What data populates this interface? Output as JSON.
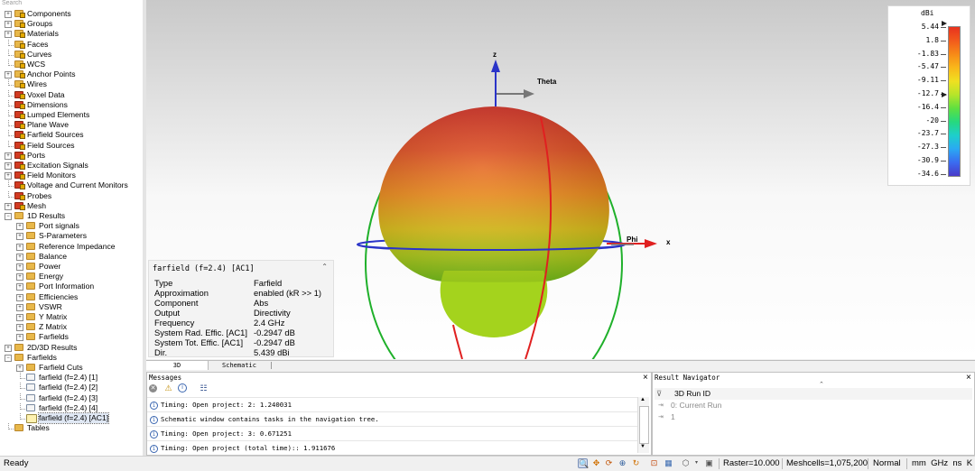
{
  "search_placeholder": "Search",
  "tree": [
    {
      "label": "Components",
      "indent": 0,
      "exp": "+",
      "icon": "folder-lock"
    },
    {
      "label": "Groups",
      "indent": 0,
      "exp": "+",
      "icon": "folder-lock"
    },
    {
      "label": "Materials",
      "indent": 0,
      "exp": "+",
      "icon": "folder-lock"
    },
    {
      "label": "Faces",
      "indent": 0,
      "exp": "",
      "icon": "folder-lock"
    },
    {
      "label": "Curves",
      "indent": 0,
      "exp": "",
      "icon": "folder-lock"
    },
    {
      "label": "WCS",
      "indent": 0,
      "exp": "",
      "icon": "folder-lock"
    },
    {
      "label": "Anchor Points",
      "indent": 0,
      "exp": "+",
      "icon": "folder-lock"
    },
    {
      "label": "Wires",
      "indent": 0,
      "exp": "",
      "icon": "folder-lock"
    },
    {
      "label": "Voxel Data",
      "indent": 0,
      "exp": "",
      "icon": "red"
    },
    {
      "label": "Dimensions",
      "indent": 0,
      "exp": "",
      "icon": "red"
    },
    {
      "label": "Lumped Elements",
      "indent": 0,
      "exp": "",
      "icon": "red"
    },
    {
      "label": "Plane Wave",
      "indent": 0,
      "exp": "",
      "icon": "red"
    },
    {
      "label": "Farfield Sources",
      "indent": 0,
      "exp": "",
      "icon": "red"
    },
    {
      "label": "Field Sources",
      "indent": 0,
      "exp": "",
      "icon": "red"
    },
    {
      "label": "Ports",
      "indent": 0,
      "exp": "+",
      "icon": "red"
    },
    {
      "label": "Excitation Signals",
      "indent": 0,
      "exp": "+",
      "icon": "red"
    },
    {
      "label": "Field Monitors",
      "indent": 0,
      "exp": "+",
      "icon": "red"
    },
    {
      "label": "Voltage and Current Monitors",
      "indent": 0,
      "exp": "",
      "icon": "red"
    },
    {
      "label": "Probes",
      "indent": 0,
      "exp": "",
      "icon": "red"
    },
    {
      "label": "Mesh",
      "indent": 0,
      "exp": "+",
      "icon": "red"
    },
    {
      "label": "1D Results",
      "indent": 0,
      "exp": "−",
      "icon": "folder"
    },
    {
      "label": "Port signals",
      "indent": 1,
      "exp": "+",
      "icon": "folder"
    },
    {
      "label": "S-Parameters",
      "indent": 1,
      "exp": "+",
      "icon": "folder"
    },
    {
      "label": "Reference Impedance",
      "indent": 1,
      "exp": "+",
      "icon": "folder"
    },
    {
      "label": "Balance",
      "indent": 1,
      "exp": "+",
      "icon": "folder"
    },
    {
      "label": "Power",
      "indent": 1,
      "exp": "+",
      "icon": "folder"
    },
    {
      "label": "Energy",
      "indent": 1,
      "exp": "+",
      "icon": "folder"
    },
    {
      "label": "Port Information",
      "indent": 1,
      "exp": "+",
      "icon": "folder"
    },
    {
      "label": "Efficiencies",
      "indent": 1,
      "exp": "+",
      "icon": "folder"
    },
    {
      "label": "VSWR",
      "indent": 1,
      "exp": "+",
      "icon": "folder"
    },
    {
      "label": "Y Matrix",
      "indent": 1,
      "exp": "+",
      "icon": "folder"
    },
    {
      "label": "Z Matrix",
      "indent": 1,
      "exp": "+",
      "icon": "folder"
    },
    {
      "label": "Farfields",
      "indent": 1,
      "exp": "+",
      "icon": "folder"
    },
    {
      "label": "2D/3D Results",
      "indent": 0,
      "exp": "+",
      "icon": "folder"
    },
    {
      "label": "Farfields",
      "indent": 0,
      "exp": "−",
      "icon": "folder"
    },
    {
      "label": "Farfield Cuts",
      "indent": 1,
      "exp": "+",
      "icon": "folder"
    },
    {
      "label": "farfield (f=2.4) [1]",
      "indent": 1,
      "exp": "",
      "icon": "file"
    },
    {
      "label": "farfield (f=2.4) [2]",
      "indent": 1,
      "exp": "",
      "icon": "file"
    },
    {
      "label": "farfield (f=2.4) [3]",
      "indent": 1,
      "exp": "",
      "icon": "file"
    },
    {
      "label": "farfield (f=2.4) [4]",
      "indent": 1,
      "exp": "",
      "icon": "file"
    },
    {
      "label": "farfield (f=2.4) [AC1]",
      "indent": 1,
      "exp": "",
      "icon": "sel",
      "selected": true
    },
    {
      "label": "Tables",
      "indent": 0,
      "exp": "",
      "icon": "folder"
    }
  ],
  "viewport": {
    "axis_z": "z",
    "axis_x": "x",
    "theta_label": "Theta",
    "phi_label": "Phi"
  },
  "legend": {
    "unit": "dBi",
    "ticks": [
      "5.44",
      "1.8",
      "-1.83",
      "-5.47",
      "-9.11",
      "-12.7",
      "-16.4",
      "-20",
      "-23.7",
      "-27.3",
      "-30.9",
      "-34.6"
    ],
    "colors": [
      "#e8321e",
      "#f25a1c",
      "#f78a18",
      "#f9b81a",
      "#f0e021",
      "#b6e52a",
      "#5fe040",
      "#26d97d",
      "#1ecfcb",
      "#2aa9f3",
      "#3a6cf0",
      "#4a3ac8"
    ]
  },
  "info": {
    "title": "farfield (f=2.4) [AC1]",
    "rows": [
      {
        "k": "Type",
        "v": "Farfield"
      },
      {
        "k": "Approximation",
        "v": "enabled (kR >> 1)"
      },
      {
        "k": "Component",
        "v": "Abs"
      },
      {
        "k": "Output",
        "v": "Directivity"
      },
      {
        "k": "Frequency",
        "v": "2.4 GHz"
      },
      {
        "k": "System Rad. Effic. [AC1]",
        "v": "-0.2947 dB"
      },
      {
        "k": "System Tot. Effic. [AC1]",
        "v": "-0.2947 dB"
      },
      {
        "k": "Dir.",
        "v": "5.439 dBi"
      }
    ]
  },
  "tabs": {
    "t3d": "3D",
    "schematic": "Schematic"
  },
  "messages": {
    "title": "Messages",
    "close": "×",
    "lines": [
      "Timing: Open project: 2: 1.240031",
      "Schematic window contains tasks in the navigation tree.",
      "Timing: Open project: 3: 0.671251",
      "Timing: Open project (total time):: 1.911676"
    ]
  },
  "result_nav": {
    "title": "Result Navigator",
    "close": "×",
    "header": "3D Run ID",
    "rows": [
      "0: Current Run",
      "1"
    ]
  },
  "status": {
    "ready": "Ready",
    "raster": "Raster=10.000",
    "meshcells": "Meshcells=1,075,200",
    "mode": "Normal",
    "units": "mm  GHz  ns  K"
  }
}
